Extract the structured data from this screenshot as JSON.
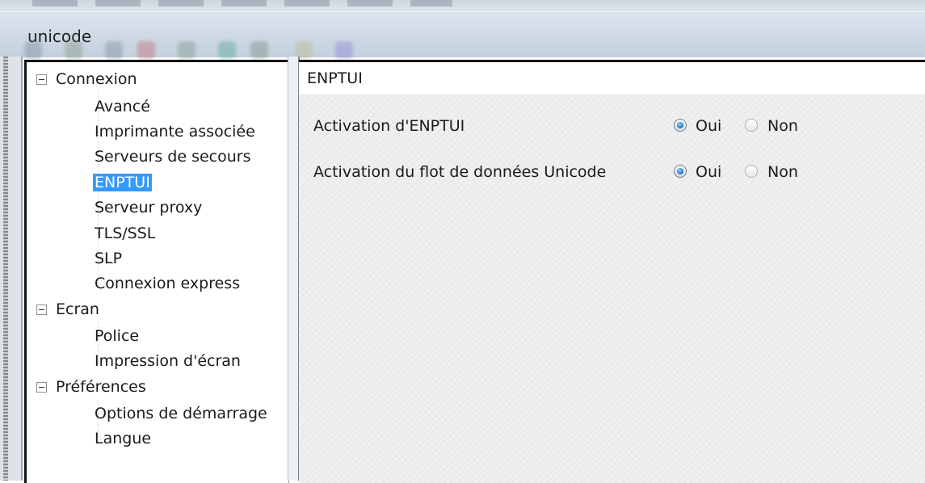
{
  "window": {
    "title": "unicode"
  },
  "tree": {
    "groups": [
      {
        "label": "Connexion",
        "children": [
          "Avancé",
          "Imprimante associée",
          "Serveurs de secours",
          "ENPTUI",
          "Serveur proxy",
          "TLS/SSL",
          "SLP",
          "Connexion express"
        ]
      },
      {
        "label": "Ecran",
        "children": [
          "Police",
          "Impression d'écran"
        ]
      },
      {
        "label": "Préférences",
        "children": [
          "Options de démarrage",
          "Langue"
        ]
      }
    ],
    "selected": "ENPTUI"
  },
  "content": {
    "section_title": "ENPTUI",
    "settings": [
      {
        "label": "Activation d'ENPTUI",
        "yes_label": "Oui",
        "no_label": "Non",
        "value": "Oui"
      },
      {
        "label": "Activation du flot de données Unicode",
        "yes_label": "Oui",
        "no_label": "Non",
        "value": "Oui"
      }
    ]
  },
  "colors": {
    "selection_background": "#3399ff",
    "selection_text": "#ffffff"
  }
}
